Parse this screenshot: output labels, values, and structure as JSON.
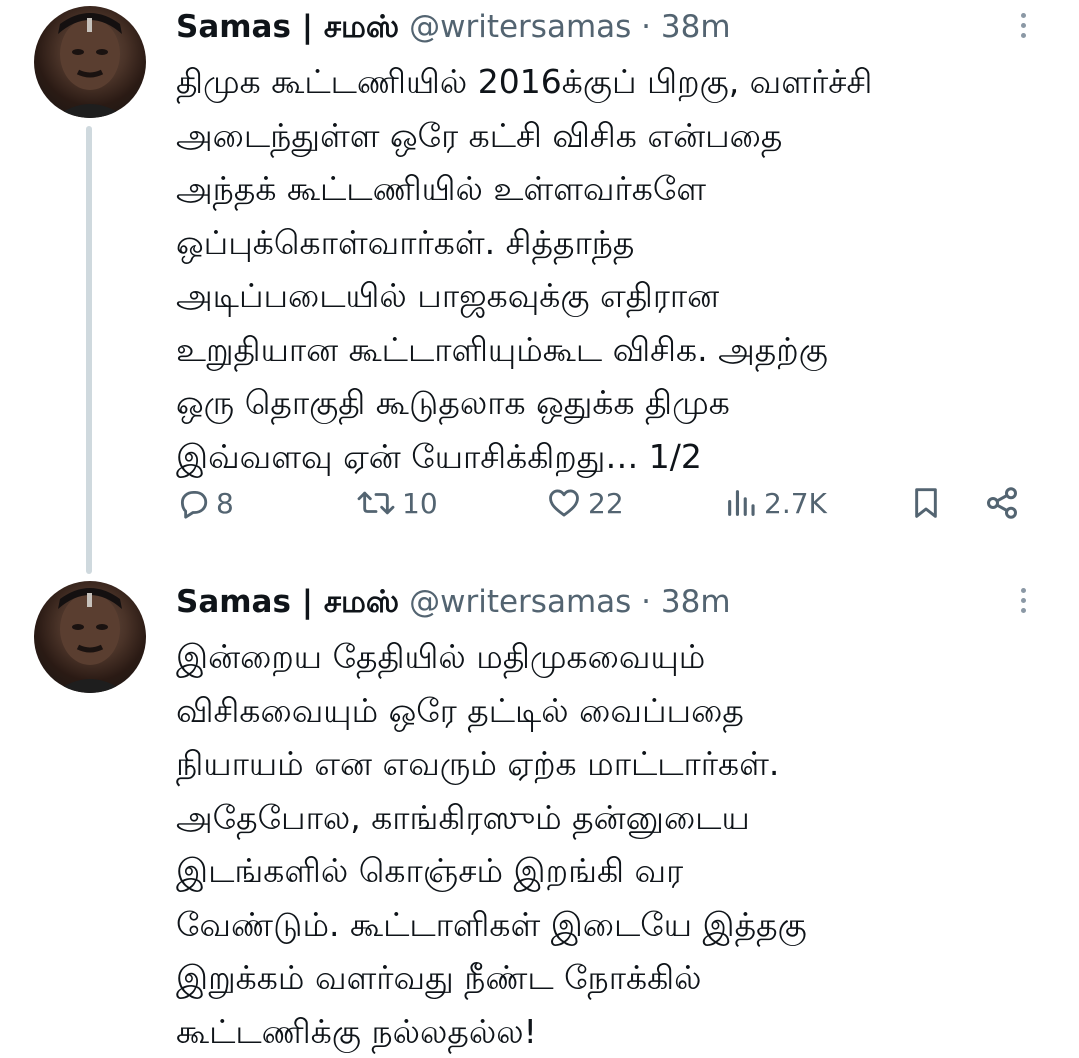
{
  "tweets": [
    {
      "display_name": "Samas | சமஸ்",
      "handle": "@writersamas",
      "separator": "·",
      "time": "38m",
      "text_lines": [
        "திமுக கூட்டணியில் 2016க்குப் பிறகு, வளர்ச்சி",
        "அடைந்துள்ள ஒரே கட்சி விசிக என்பதை",
        "அந்தக் கூட்டணியில் உள்ளவர்களே",
        "ஒப்புக்கொள்வார்கள். சித்தாந்த",
        "அடிப்படையில் பாஜகவுக்கு எதிரான",
        "உறுதியான கூட்டாளியும்கூட விசிக. அதற்கு",
        "ஒரு தொகுதி கூடுதலாக ஒதுக்க திமுக",
        "இவ்வளவு ஏன் யோசிக்கிறது… 1/2"
      ],
      "actions": {
        "replies": "8",
        "retweets": "10",
        "likes": "22",
        "views": "2.7K"
      }
    },
    {
      "display_name": "Samas | சமஸ்",
      "handle": "@writersamas",
      "separator": "·",
      "time": "38m",
      "text_lines": [
        "இன்றைய தேதியில் மதிமுகவையும்",
        "விசிகவையும் ஒரே தட்டில் வைப்பதை",
        "நியாயம் என எவரும் ஏற்க மாட்டார்கள்.",
        "அதேபோல, காங்கிரஸும் தன்னுடைய",
        "இடங்களில் கொஞ்சம் இறங்கி வர",
        "வேண்டும். கூட்டாளிகள் இடையே இத்தகு",
        "இறுக்கம் வளர்வது நீண்ட நோக்கில்",
        "கூட்டணிக்கு நல்லதல்ல!"
      ]
    }
  ],
  "icons": [
    "reply-icon",
    "retweet-icon",
    "like-icon",
    "views-icon",
    "bookmark-icon",
    "share-icon",
    "more-icon"
  ],
  "colors": {
    "text": "#0f1419",
    "muted": "#536471",
    "thread_line": "#cfd9de"
  }
}
